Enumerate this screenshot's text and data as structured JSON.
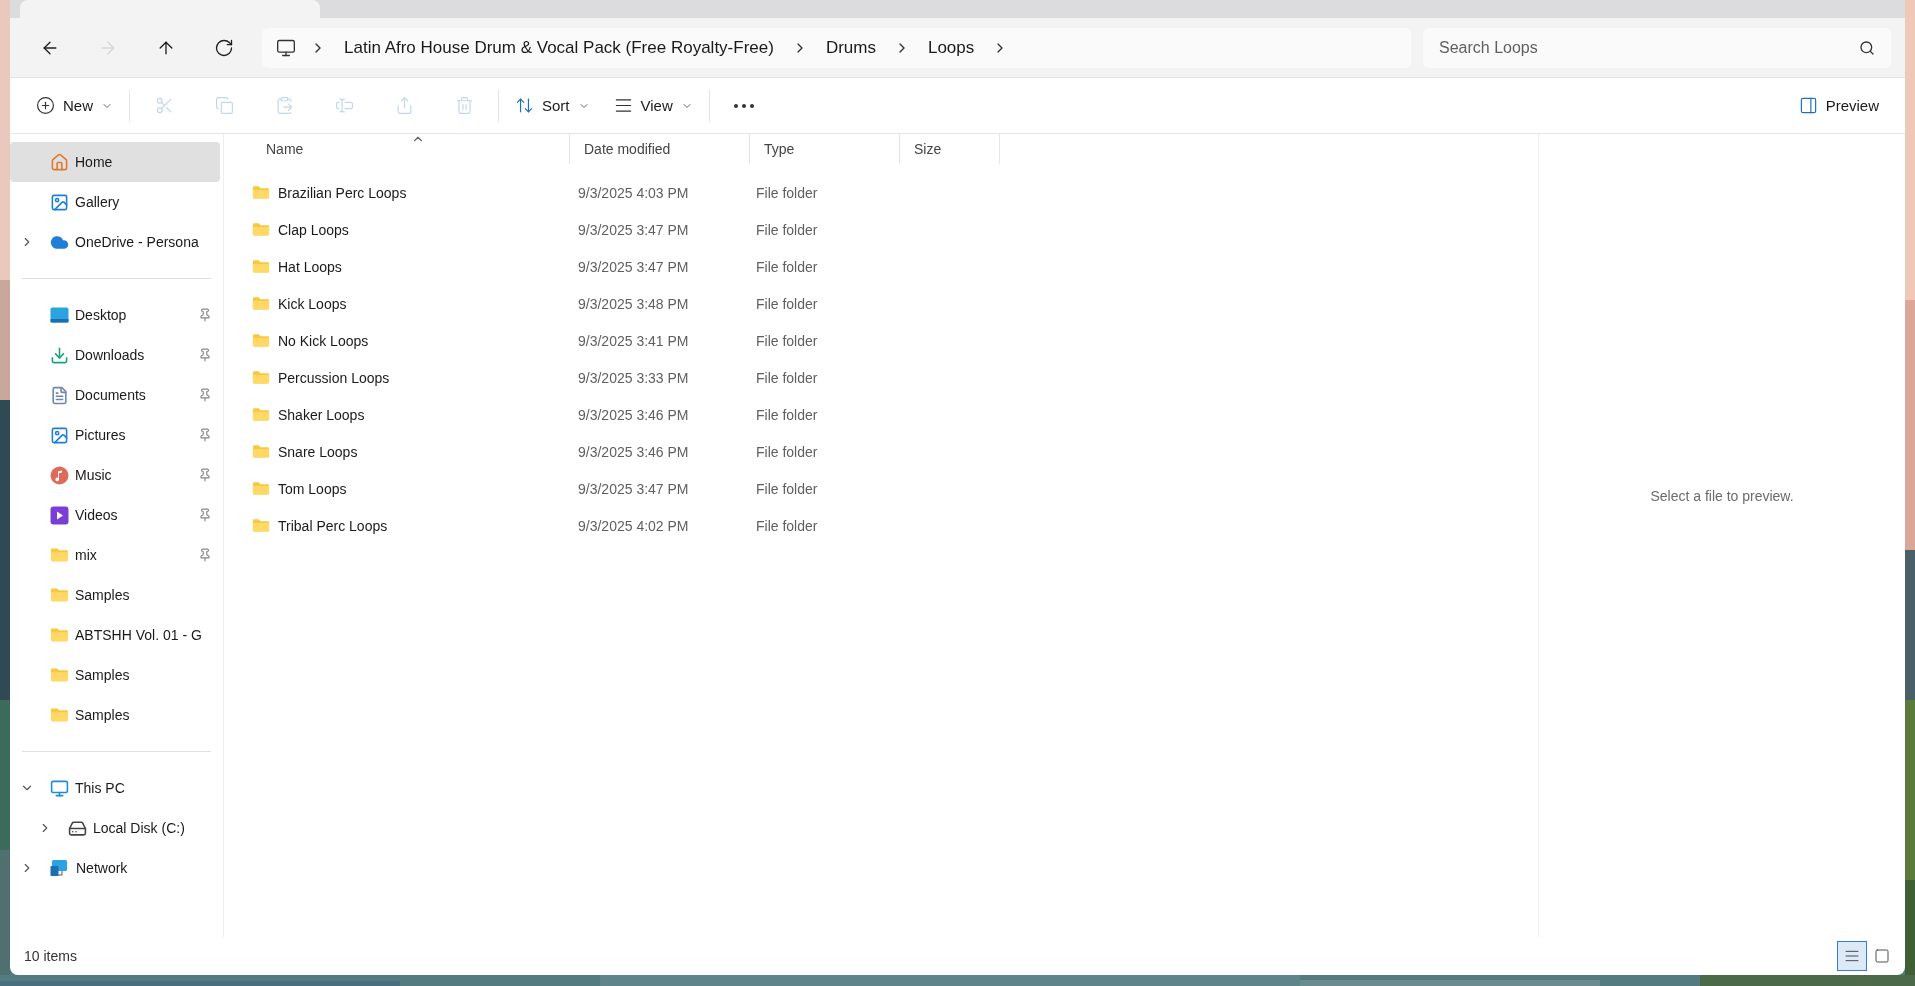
{
  "navigation": [
    {
      "kind": "back",
      "disabled": false
    },
    {
      "kind": "forward",
      "disabled": true
    },
    {
      "kind": "up",
      "disabled": false
    },
    {
      "kind": "refresh",
      "disabled": false
    }
  ],
  "breadcrumb": [
    "Latin Afro House Drum & Vocal Pack (Free Royalty-Free)",
    "Drums",
    "Loops"
  ],
  "search": {
    "placeholder": "Search Loops"
  },
  "toolbar": [
    {
      "kind": "new",
      "label": "New",
      "disabled": false
    },
    {
      "kind": "cut",
      "disabled": true
    },
    {
      "kind": "copy",
      "disabled": true
    },
    {
      "kind": "paste",
      "disabled": true
    },
    {
      "kind": "rename",
      "disabled": true
    },
    {
      "kind": "share",
      "disabled": true
    },
    {
      "kind": "delete",
      "disabled": true
    },
    {
      "kind": "sort",
      "label": "Sort",
      "disabled": false
    },
    {
      "kind": "view",
      "label": "View",
      "disabled": false
    },
    {
      "kind": "more",
      "disabled": false
    }
  ],
  "preview_button": {
    "label": "Preview",
    "on": true
  },
  "sidebar": {
    "sections": [
      {
        "items": [
          {
            "kind": "home",
            "label": "Home",
            "selected": true
          },
          {
            "kind": "gallery",
            "label": "Gallery",
            "selected": false
          },
          {
            "kind": "cloud",
            "label": "OneDrive - Persona",
            "selected": false,
            "expanded": false
          }
        ]
      },
      {
        "items": [
          {
            "kind": "desktop",
            "label": "Desktop",
            "selected": false,
            "pinned": true
          },
          {
            "kind": "download",
            "label": "Downloads",
            "selected": false,
            "pinned": true
          },
          {
            "kind": "document",
            "label": "Documents",
            "selected": false,
            "pinned": true
          },
          {
            "kind": "pictures",
            "label": "Pictures",
            "selected": false,
            "pinned": true
          },
          {
            "kind": "music",
            "label": "Music",
            "selected": false,
            "pinned": true
          },
          {
            "kind": "videos",
            "label": "Videos",
            "selected": false,
            "pinned": true
          },
          {
            "kind": "folder",
            "label": "mix",
            "selected": false,
            "pinned": true
          },
          {
            "kind": "folder",
            "label": "Samples",
            "selected": false,
            "pinned": false
          },
          {
            "kind": "folder",
            "label": "ABTSHH Vol. 01 - G",
            "selected": false,
            "pinned": false
          },
          {
            "kind": "folder",
            "label": "Samples",
            "selected": false,
            "pinned": false
          },
          {
            "kind": "folder",
            "label": "Samples",
            "selected": false,
            "pinned": false
          }
        ]
      },
      {
        "items": [
          {
            "kind": "pc",
            "label": "This PC",
            "selected": false,
            "expanded": true,
            "children": [
              {
                "kind": "drive",
                "label": "Local Disk (C:)",
                "selected": false,
                "expanded": false
              }
            ]
          },
          {
            "kind": "network",
            "label": "Network",
            "selected": false,
            "expanded": false
          }
        ]
      }
    ]
  },
  "table": {
    "columns": [
      {
        "label": "Name",
        "sorted": true
      },
      {
        "label": "Date modified",
        "sorted": false
      },
      {
        "label": "Type",
        "sorted": false
      },
      {
        "label": "Size",
        "sorted": false
      }
    ],
    "rows": [
      {
        "name": "Brazilian Perc Loops",
        "date": "9/3/2025 4:03 PM",
        "type": "File folder"
      },
      {
        "name": "Clap Loops",
        "date": "9/3/2025 3:47 PM",
        "type": "File folder"
      },
      {
        "name": "Hat Loops",
        "date": "9/3/2025 3:47 PM",
        "type": "File folder"
      },
      {
        "name": "Kick Loops",
        "date": "9/3/2025 3:48 PM",
        "type": "File folder"
      },
      {
        "name": "No Kick Loops",
        "date": "9/3/2025 3:41 PM",
        "type": "File folder"
      },
      {
        "name": "Percussion Loops",
        "date": "9/3/2025 3:33 PM",
        "type": "File folder"
      },
      {
        "name": "Shaker Loops",
        "date": "9/3/2025 3:46 PM",
        "type": "File folder"
      },
      {
        "name": "Snare Loops",
        "date": "9/3/2025 3:46 PM",
        "type": "File folder"
      },
      {
        "name": "Tom Loops",
        "date": "9/3/2025 3:47 PM",
        "type": "File folder"
      },
      {
        "name": "Tribal Perc Loops",
        "date": "9/3/2025 4:02 PM",
        "type": "File folder"
      }
    ]
  },
  "preview": {
    "message": "Select a file to preview."
  },
  "status_bar": {
    "count": "10 items",
    "views": [
      {
        "kind": "details",
        "selected": true
      },
      {
        "kind": "tiles",
        "selected": false
      }
    ]
  }
}
